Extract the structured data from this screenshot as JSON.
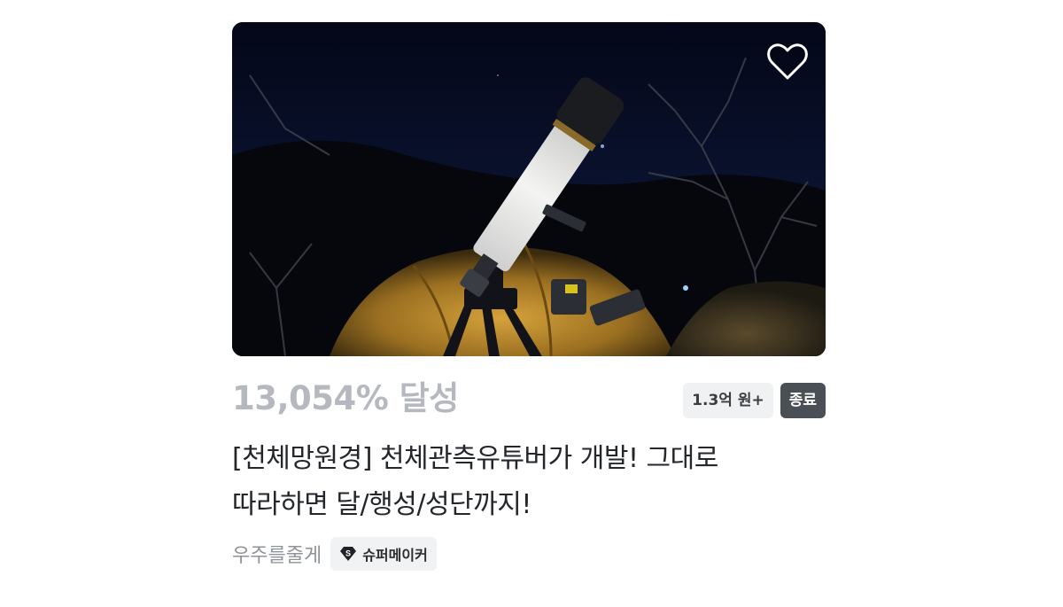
{
  "project": {
    "image_alt": "천체망원경 사진",
    "achievement": "13,054% 달성",
    "amount_badge": "1.3억 원+",
    "status_badge": "종료",
    "title_line1": "[천체망원경] 천체관측유튜버가 개발! 그대로",
    "title_line2": "따라하면 달/행성/성단까지!",
    "maker": "우주를줄게",
    "maker_badge": "슈퍼메이커",
    "maker_badge_icon_letter": "S",
    "like_icon": "heart-outline-icon"
  },
  "colors": {
    "achievement": "#b5b9bf",
    "status_bg": "#4a4f56",
    "amount_bg": "#f0f1f3",
    "title": "#23262b",
    "maker": "#8e9399"
  }
}
